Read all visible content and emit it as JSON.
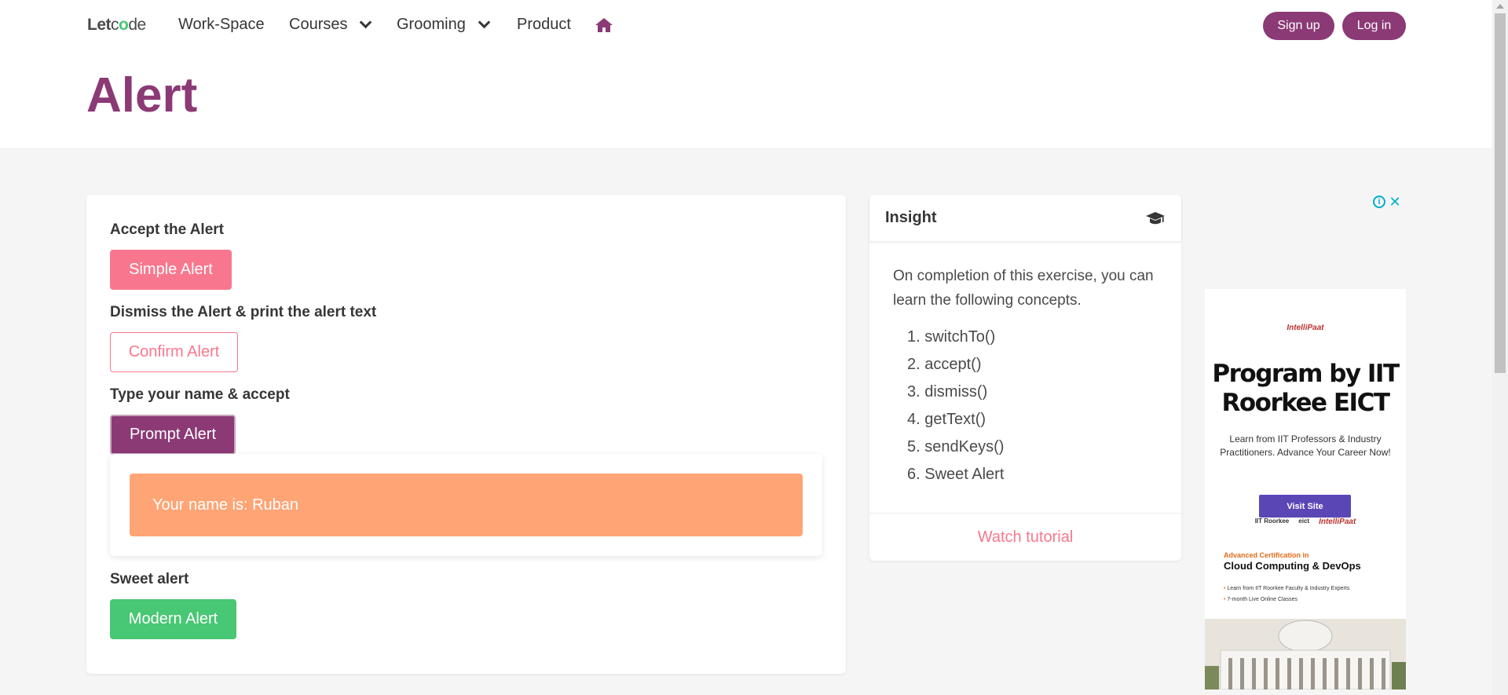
{
  "nav": {
    "brand_let": "Let",
    "brand_c": "c",
    "brand_o": "o",
    "brand_de": "de",
    "items": {
      "workspace": "Work-Space",
      "courses": "Courses",
      "grooming": "Grooming",
      "product": "Product"
    },
    "signup": "Sign up",
    "login": "Log in"
  },
  "hero": {
    "title": "Alert"
  },
  "main": {
    "accept_label": "Accept the Alert",
    "simple_btn": "Simple Alert",
    "dismiss_label": "Dismiss the Alert & print the alert text",
    "confirm_btn": "Confirm Alert",
    "prompt_label": "Type your name & accept",
    "prompt_btn": "Prompt Alert",
    "result_text": "Your name is: Ruban",
    "sweet_label": "Sweet alert",
    "modern_btn": "Modern Alert"
  },
  "insight": {
    "title": "Insight",
    "intro": "On completion of this exercise, you can learn the following concepts.",
    "concepts": [
      "1. switchTo()",
      "2. accept()",
      "3. dismiss()",
      "4. getText()",
      "5. sendKeys()",
      "6. Sweet Alert"
    ],
    "footer_link": "Watch tutorial"
  },
  "ad": {
    "logo": "IntelliPaat",
    "title": "Program by IIT Roorkee EICT",
    "subtitle": "Learn from IIT Professors & Industry Practitioners. Advance Your Career Now!",
    "button": "Visit Site",
    "partner1": "IIT Roorkee",
    "partner2": "eict",
    "partner3": "IntelliPaat",
    "cert_kicker": "Advanced Certification in",
    "cert_title": "Cloud Computing & DevOps",
    "bullet1": "Learn from IIT Roorkee Faculty & Industry Experts",
    "bullet2": "7-month Live Online Classes"
  },
  "colors": {
    "brand": "#8b3a75",
    "pink": "#f9778e",
    "green": "#48c774",
    "orange": "#ffa474"
  },
  "icons": {
    "home": "home-icon",
    "cap": "graduation-cap-icon",
    "chevron": "chevron-down-icon"
  }
}
